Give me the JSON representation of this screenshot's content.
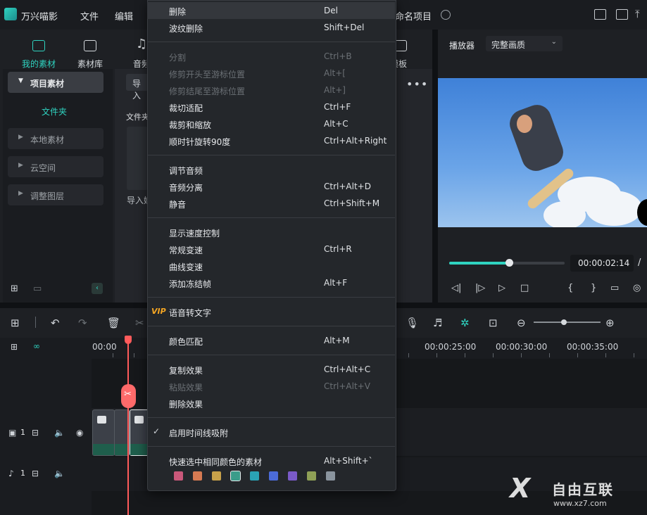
{
  "app": {
    "title": "万兴喵影",
    "project_name": "命名项目"
  },
  "menus": [
    "文件",
    "编辑"
  ],
  "asset_tabs": [
    "我的素材",
    "素材库",
    "音频",
    "模板"
  ],
  "sidebar": {
    "header": "项目素材",
    "folder_label": "文件夹",
    "items": [
      "本地素材",
      "云空间",
      "调整图层"
    ]
  },
  "content": {
    "import_button": "导入",
    "folder_column": "文件夹",
    "import_label": "导入媒",
    "more": "•••"
  },
  "player": {
    "label": "播放器",
    "quality": "完整画质",
    "timecode": "00:00:02:14",
    "progress": 0.52
  },
  "timeline": {
    "ruler_labels": [
      "00:00",
      "00:00:25:00",
      "00:00:30:00",
      "00:00:35:00"
    ],
    "video_track_label": "1",
    "audio_track_label": "1",
    "zoom_level": 0.45
  },
  "context_menu": {
    "groups": [
      [
        {
          "label": "删除",
          "shortcut": "Del",
          "enabled": true,
          "highlighted": true
        },
        {
          "label": "波纹删除",
          "shortcut": "Shift+Del",
          "enabled": true
        }
      ],
      [
        {
          "label": "分割",
          "shortcut": "Ctrl+B",
          "enabled": false
        },
        {
          "label": "修剪开头至游标位置",
          "shortcut": "Alt+[",
          "enabled": false
        },
        {
          "label": "修剪结尾至游标位置",
          "shortcut": "Alt+]",
          "enabled": false
        },
        {
          "label": "裁切适配",
          "shortcut": "Ctrl+F",
          "enabled": true
        },
        {
          "label": "裁剪和缩放",
          "shortcut": "Alt+C",
          "enabled": true
        },
        {
          "label": "顺时针旋转90度",
          "shortcut": "Ctrl+Alt+Right",
          "enabled": true
        }
      ],
      [
        {
          "label": "调节音频",
          "shortcut": "",
          "enabled": true
        },
        {
          "label": "音频分离",
          "shortcut": "Ctrl+Alt+D",
          "enabled": true
        },
        {
          "label": "静音",
          "shortcut": "Ctrl+Shift+M",
          "enabled": true
        }
      ],
      [
        {
          "label": "显示速度控制",
          "shortcut": "",
          "enabled": true
        },
        {
          "label": "常规变速",
          "shortcut": "Ctrl+R",
          "enabled": true
        },
        {
          "label": "曲线变速",
          "shortcut": "",
          "enabled": true
        },
        {
          "label": "添加冻结帧",
          "shortcut": "Alt+F",
          "enabled": true
        }
      ],
      [
        {
          "label": "语音转文字",
          "shortcut": "",
          "enabled": true,
          "badge": "VIP"
        }
      ],
      [
        {
          "label": "颜色匹配",
          "shortcut": "Alt+M",
          "enabled": true
        }
      ],
      [
        {
          "label": "复制效果",
          "shortcut": "Ctrl+Alt+C",
          "enabled": true
        },
        {
          "label": "粘贴效果",
          "shortcut": "Ctrl+Alt+V",
          "enabled": false
        },
        {
          "label": "删除效果",
          "shortcut": "",
          "enabled": true
        }
      ],
      [
        {
          "label": "启用时间线吸附",
          "shortcut": "",
          "enabled": true,
          "checked": true
        }
      ],
      [
        {
          "label": "快速选中相同颜色的素材",
          "shortcut": "Alt+Shift+`",
          "enabled": true
        }
      ]
    ],
    "swatches": [
      "#c9587a",
      "#d67a52",
      "#c7a14a",
      "#3a9c8a",
      "#2aa3b5",
      "#4b6bd8",
      "#7a5ac8",
      "#8fa056",
      "#8a949e"
    ]
  },
  "watermark": {
    "logo": "X",
    "text": "自由互联",
    "url": "www.xz7.com"
  },
  "colors": {
    "accent": "#2fd3c0",
    "playhead": "#ff5b5b",
    "vip": "#f5a623"
  }
}
